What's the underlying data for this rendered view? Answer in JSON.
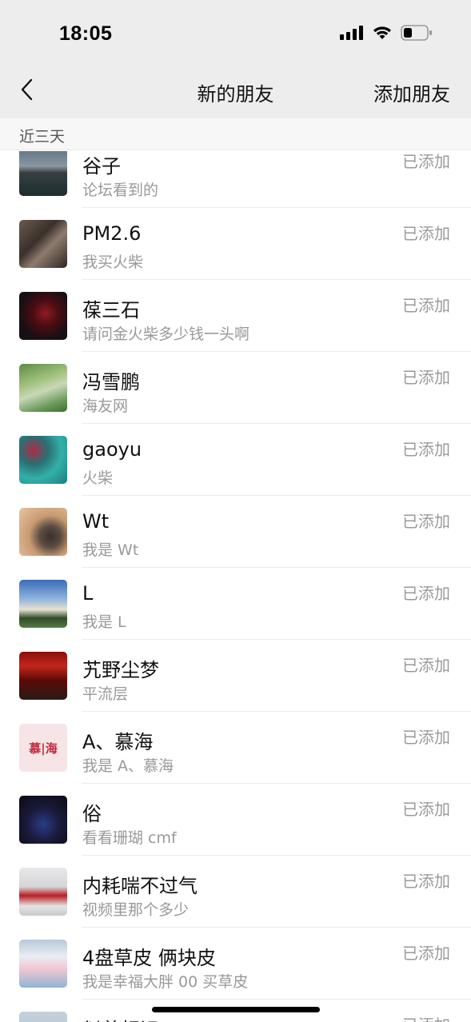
{
  "status_bar": {
    "time": "18:05"
  },
  "nav": {
    "title": "新的朋友",
    "action_label": "添加朋友"
  },
  "section": {
    "label": "近三天"
  },
  "requests": [
    {
      "name": "谷子",
      "message": "论坛看到的",
      "status": "已添加"
    },
    {
      "name": "PM2.6",
      "message": "我买火柴",
      "status": "已添加"
    },
    {
      "name": "葆三石",
      "message": "请问金火柴多少钱一头啊",
      "status": "已添加"
    },
    {
      "name": "冯雪鹏",
      "message": "海友网",
      "status": "已添加"
    },
    {
      "name": "gaoyu",
      "message": "火柴",
      "status": "已添加"
    },
    {
      "name": "Wt",
      "message": "我是 Wt",
      "status": "已添加"
    },
    {
      "name": "L",
      "message": "我是 L",
      "status": "已添加"
    },
    {
      "name": "艽野尘梦",
      "message": "平流层",
      "status": "已添加"
    },
    {
      "name": "A、慕海",
      "message": "我是 A、慕海",
      "status": "已添加",
      "avatar_text": "慕|海"
    },
    {
      "name": "俗",
      "message": "看看珊瑚 cmf",
      "status": "已添加"
    },
    {
      "name": "内耗喘不过气",
      "message": "视频里那个多少",
      "status": "已添加"
    },
    {
      "name": "4盘草皮 俩块皮",
      "message": "我是幸福大胖 00 买草皮",
      "status": "已添加"
    },
    {
      "name": "似曾相识",
      "message": "",
      "status": "已添加"
    }
  ]
}
